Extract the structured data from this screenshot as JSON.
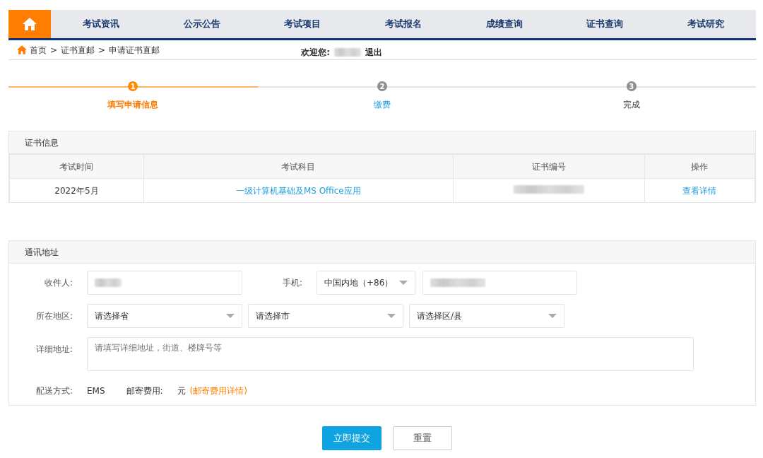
{
  "nav": {
    "items": [
      {
        "label": "考试资讯"
      },
      {
        "label": "公示公告"
      },
      {
        "label": "考试项目"
      },
      {
        "label": "考试报名"
      },
      {
        "label": "成绩查询"
      },
      {
        "label": "证书查询"
      },
      {
        "label": "考试研究"
      }
    ]
  },
  "breadcrumb": [
    "首页",
    "证书直邮",
    "申请证书直邮"
  ],
  "breadcrumb_separator": ">",
  "welcome": {
    "label": "欢迎您:",
    "name_masked": true,
    "logout": "退出"
  },
  "steps": [
    {
      "number": "1",
      "label": "填写申请信息",
      "kind": "current"
    },
    {
      "number": "2",
      "label": "缴费",
      "kind": "link"
    },
    {
      "number": "3",
      "label": "完成",
      "kind": "plain"
    }
  ],
  "certificate": {
    "title": "证书信息",
    "columns": [
      "考试时间",
      "考试科目",
      "证书编号",
      "操作"
    ],
    "rows": [
      {
        "time": "2022年5月",
        "subject": "一级计算机基础及MS Office应用",
        "number_masked": true,
        "action": "查看详情"
      }
    ]
  },
  "address": {
    "title": "通讯地址",
    "recipient": {
      "label": "收件人:",
      "masked": true
    },
    "phone": {
      "label": "手机:",
      "region": "中国内地（+86）",
      "masked": true
    },
    "area": {
      "label": "所在地区:",
      "selects": [
        "请选择省",
        "请选择市",
        "请选择区/县"
      ]
    },
    "detail": {
      "label": "详细地址:",
      "placeholder": "请填写详细地址，街道、楼牌号等"
    },
    "delivery": {
      "label": "配送方式:",
      "value": "EMS",
      "fee_label": "邮寄费用:",
      "fee_unit": "元",
      "fee_link": "(邮寄费用详情)"
    }
  },
  "buttons": [
    {
      "label": "立即提交",
      "kind": "primary"
    },
    {
      "label": "重置",
      "kind": "secondary"
    }
  ]
}
